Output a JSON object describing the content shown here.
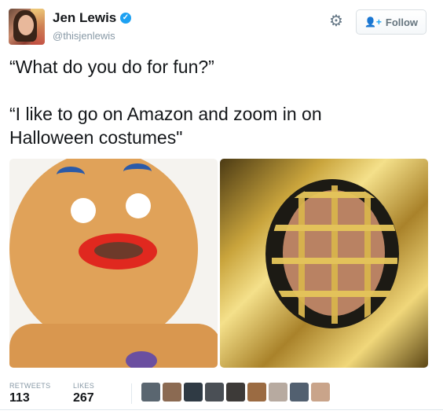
{
  "author": {
    "name": "Jen Lewis",
    "handle": "@thisjenlewis",
    "verified_mark": "✓"
  },
  "header": {
    "gear_glyph": "⚙",
    "follow_label": "Follow",
    "follow_icon": "person-plus-icon"
  },
  "tweet": {
    "line1": "“What do you do for fun?”",
    "line2": "“I like to go on Amazon and zoom in on",
    "line3": "Halloween costumes\""
  },
  "stats": {
    "retweets_label": "RETWEETS",
    "retweets_value": "113",
    "likes_label": "LIKES",
    "likes_value": "267"
  },
  "colors": {
    "accent": "#1da1f2",
    "muted": "#8899a6"
  },
  "facepile": [
    {
      "color": "#5a6670"
    },
    {
      "color": "#8b6a52"
    },
    {
      "color": "#2f3a44"
    },
    {
      "color": "#4a4f55"
    },
    {
      "color": "#3d3a38"
    },
    {
      "color": "#9b6b42"
    },
    {
      "color": "#b7aaa0"
    },
    {
      "color": "#526070"
    },
    {
      "color": "#c9a48a"
    }
  ]
}
